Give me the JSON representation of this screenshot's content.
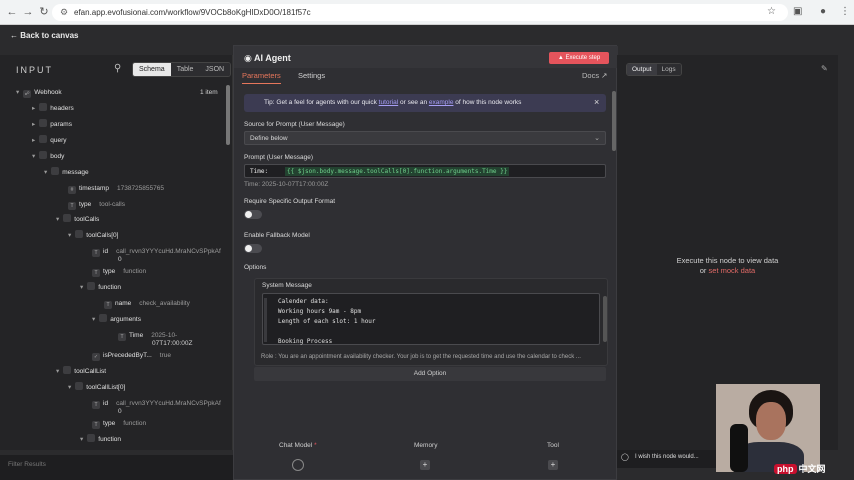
{
  "browser": {
    "url": "efan.app.evofusionai.com/workflow/9VOCb8oKgHIDxD0O/181f57c"
  },
  "topbar": {
    "back_label": "Back to canvas"
  },
  "input_panel": {
    "title": "INPUT",
    "view_tabs": [
      "Schema",
      "Table",
      "JSON"
    ],
    "active_view": "Schema",
    "node_name": "Webhook",
    "item_count": "1 item",
    "fields": {
      "headers": "headers",
      "params": "params",
      "query": "query",
      "body": "body",
      "message": "message",
      "timestamp_key": "timestamp",
      "timestamp_val": "1738725855765",
      "type_key": "type",
      "type_val": "tool-calls",
      "toolcalls": "toolCalls",
      "toolcalls0": "toolCalls[0]",
      "id_key": "id",
      "id_val": "call_rvvn3YYYcuHd.MraNCvSPpkAf",
      "id_val_wrap": "0",
      "type2_key": "type",
      "type2_val": "function",
      "function_key": "function",
      "name_key": "name",
      "name_val": "check_availability",
      "arguments_key": "arguments",
      "time_key": "Time",
      "time_val1": "2025-10-",
      "time_val2": "07T17:00:00Z",
      "ispreceded_key": "isPrecededByT...",
      "ispreceded_val": "true",
      "toolcalllist": "toolCallList",
      "toolcalllist0": "toolCallList[0]",
      "id3_key": "id",
      "id3_val": "call_rvvn3YYYcuHd.MraNCvSPpkAf",
      "id3_val_wrap": "0",
      "type3_key": "type",
      "type3_val": "function",
      "function2_key": "function"
    },
    "footer_hint": "Filter Results"
  },
  "modal": {
    "title": "AI Agent",
    "execute_label": "Execute step",
    "tabs": [
      "Parameters",
      "Settings"
    ],
    "active_tab": "Parameters",
    "docs_label": "Docs",
    "tip": {
      "prefix": "Tip: Get a feel for agents with our quick ",
      "link1": "tutorial",
      "middle": " or see an ",
      "link2": "example",
      "suffix": " of how this node works"
    },
    "source_label": "Source for Prompt (User Message)",
    "source_value": "Define below",
    "prompt_label": "Prompt (User Message)",
    "prompt_fx": "Time:",
    "prompt_expr": "{{ $json.body.message.toolCalls[0].function.arguments.Time }}",
    "prompt_result": "Time: 2025-10-07T17:00:00Z",
    "require_label": "Require Specific Output Format",
    "fallback_label": "Enable Fallback Model",
    "options_label": "Options",
    "system_label": "System Message",
    "system_lines": [
      "Calender data:",
      "Working hours 9am - 8pm",
      "Length of each slot: 1 hour",
      "",
      "Booking Process"
    ],
    "role_text": "Role : You are an appointment availability checker. Your job is to get the requested time and use the calendar to check ...",
    "add_option_label": "Add Option",
    "bottom_columns": [
      {
        "label": "Chat Model",
        "required": "*"
      },
      {
        "label": "Memory",
        "required": ""
      },
      {
        "label": "Tool",
        "required": ""
      }
    ]
  },
  "output_panel": {
    "tabs": [
      "Output",
      "Logs"
    ],
    "active_tab": "Output",
    "exec_text": "Execute this node to view data",
    "exec_or": "or ",
    "exec_link": "set mock data"
  },
  "wish_text": "I wish this node would...",
  "watermark_text": "中文网",
  "watermark_badge": "php",
  "colors": {
    "accent": "#e6765b",
    "execute": "#e5545c",
    "tip_bg": "#3c3b52",
    "link": "#a69ef5",
    "expr_green": "#6fd18c"
  }
}
